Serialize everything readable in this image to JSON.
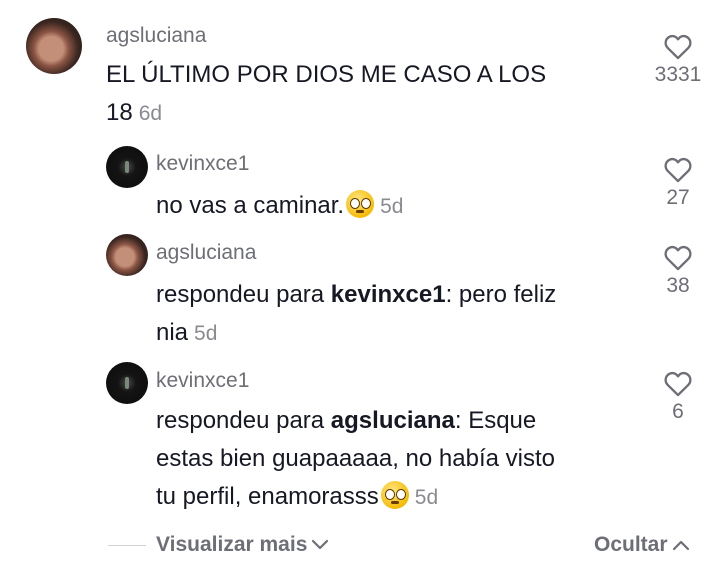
{
  "comments": [
    {
      "username": "agsluciana",
      "text_line1": "EL ÚLTIMO POR DIOS ME CASO A LOS",
      "text_line2": "18",
      "time": "6d",
      "likes": "3331"
    },
    {
      "username": "kevinxce1",
      "text": "no vas a caminar.",
      "time": "5d",
      "likes": "27"
    },
    {
      "username": "agsluciana",
      "reply_prefix": "respondeu para ",
      "reply_to": "kevinxce1",
      "text_line1": ": pero feliz",
      "text_line2": "nia",
      "time": "5d",
      "likes": "38"
    },
    {
      "username": "kevinxce1",
      "reply_prefix": "respondeu para ",
      "reply_to": "agsluciana",
      "text_line1": ": Esque",
      "text_line2": "estas bien guapaaaaa, no había visto",
      "text_line3": "tu perfil, enamorasss",
      "time": "5d",
      "likes": "6"
    }
  ],
  "footer": {
    "view_more": "Visualizar mais",
    "hide": "Ocultar"
  },
  "icons": {
    "like": "heart-outline-icon",
    "expand": "chevron-down-icon",
    "collapse": "chevron-up-icon",
    "emoji": "flushed-face-emoji"
  }
}
